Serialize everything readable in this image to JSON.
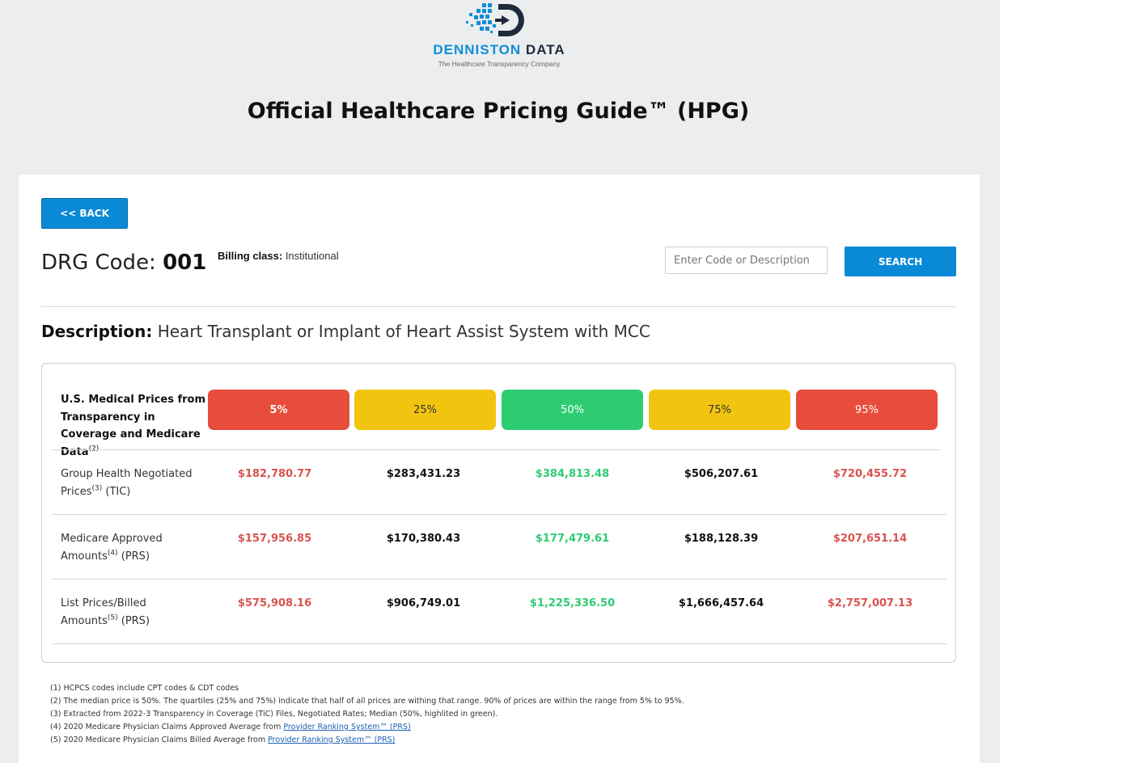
{
  "logo": {
    "word_1": "DENNISTON",
    "word_2": "DATA",
    "tagline": "The Healthcare Transparency Company"
  },
  "page_title": "Official Healthcare Pricing Guide™ (HPG)",
  "back_label": "<< BACK",
  "drg": {
    "prefix": "DRG Code: ",
    "code": "001",
    "billing_label": "Billing class:",
    "billing_value": " Institutional"
  },
  "search": {
    "placeholder": "Enter Code or Description",
    "button_label": "SEARCH"
  },
  "description": {
    "label": "Description:",
    "text": " Heart Transplant or Implant of Heart Assist System with MCC"
  },
  "table": {
    "header_label": "U.S. Medical Prices from Transparency in Coverage and Medicare Data",
    "header_sup": "(2)",
    "percentiles": [
      "5%",
      "25%",
      "50%",
      "75%",
      "95%"
    ],
    "rows": [
      {
        "label_1": "Group Health Negotiated",
        "label_2a": "Prices",
        "sup": "(3)",
        "label_2b": " (TIC)",
        "values": [
          "$182,780.77",
          "$283,431.23",
          "$384,813.48",
          "$506,207.61",
          "$720,455.72"
        ]
      },
      {
        "label_1": "Medicare Approved",
        "label_2a": "Amounts",
        "sup": "(4)",
        "label_2b": " (PRS)",
        "values": [
          "$157,956.85",
          "$170,380.43",
          "$177,479.61",
          "$188,128.39",
          "$207,651.14"
        ]
      },
      {
        "label_1": "List Prices/Billed",
        "label_2a": "Amounts",
        "sup": "(5)",
        "label_2b": " (PRS)",
        "values": [
          "$575,908.16",
          "$906,749.01",
          "$1,225,336.50",
          "$1,666,457.64",
          "$2,757,007.13"
        ]
      }
    ]
  },
  "footnotes": {
    "f1": "(1) HCPCS codes include CPT codes & CDT codes",
    "f2": "(2) The median price is 50%. The quartiles (25% and 75%) indicate that half of all prices are withing that range. 90% of prices are within the range from 5% to 95%.",
    "f3": "(3) Extracted from 2022-3 Transparency in Coverage (TiC) Files, Negotiated Rates; Median (50%, highlited in green).",
    "f4_text": "(4) 2020 Medicare Physician Claims Approved Average from ",
    "f4_link": "Provider Ranking System™ (PRS)",
    "f5_text": "(5) 2020 Medicare Physician Claims Billed Average from ",
    "f5_link": "Provider Ranking System™ (PRS)"
  },
  "colors": {
    "background_gray": "#ecedef",
    "button_blue": "#0a8ad6",
    "red": "#e74c3c",
    "yellow": "#f1c40f",
    "green": "#2ecc71",
    "logo_blue": "#0d8fd8",
    "logo_dark": "#1d2a3a"
  }
}
